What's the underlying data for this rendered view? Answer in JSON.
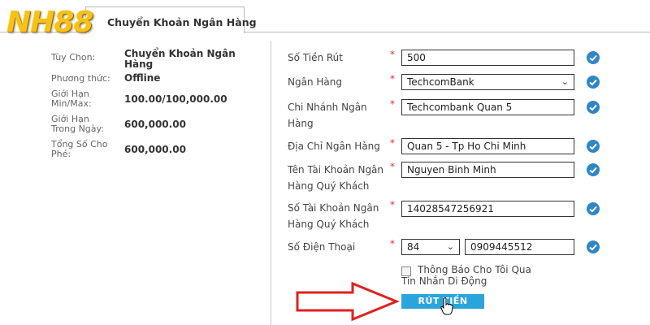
{
  "logo": {
    "text": "NH88"
  },
  "tab": {
    "label": "Chuyển Khoản Ngân Hàng"
  },
  "info": {
    "option_label": "Tùy Chọn:",
    "option_value": "Chuyển Khoản Ngân Hàng",
    "method_label": "Phương thức:",
    "method_value": "Offline",
    "limit_label": "Giới Hạn Min/Max:",
    "limit_value": "100.00/100,000.00",
    "daily_label": "Giới Hạn Trong Ngày:",
    "daily_value": "600,000.00",
    "fee_label": "Tổng Số Cho Phé:",
    "fee_value": "600,000.00"
  },
  "form": {
    "required_mark": "*",
    "amount": {
      "label": "Số Tiền Rút",
      "value": "500"
    },
    "bank": {
      "label": "Ngân Hàng",
      "value": "TechcomBank"
    },
    "branch": {
      "label": "Chi Nhánh Ngân Hàng",
      "value": "Techcombank Quan 5"
    },
    "address": {
      "label": "Địa Chỉ Ngân Hàng",
      "value": "Quan 5 - Tp Ho Chi Minh"
    },
    "account_name": {
      "label": "Tên Tài Khoản Ngân Hàng Quý Khách",
      "value": "Nguyen Binh Minh"
    },
    "account_number": {
      "label": "Số Tài Khoản Ngân Hàng Quý Khách",
      "value": "14028547256921"
    },
    "phone": {
      "label": "Số Điện Thoại",
      "country_code": "84",
      "value": "0909445512"
    },
    "notify_label": "Thông Báo Cho Tôi Qua Tin Nhắn Di Động",
    "submit_label": "RÚT TIỀN"
  },
  "colors": {
    "logo_gold": "#f6c21a",
    "check_blue": "#2f86c4",
    "button_blue": "#2aa5dc",
    "required_red": "#e03030",
    "arrow_red": "#e02020"
  },
  "icons": [
    "check-circle-icon",
    "chevron-down-icon",
    "red-arrow-icon",
    "hand-cursor-icon"
  ]
}
